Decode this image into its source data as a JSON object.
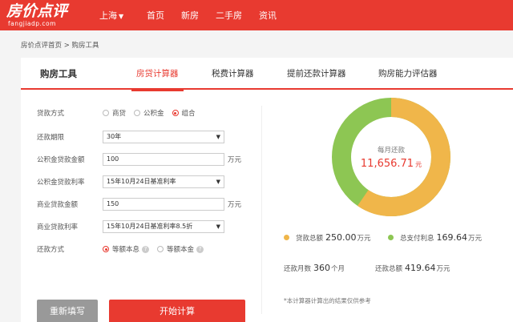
{
  "header": {
    "logo_main": "房价点评",
    "logo_sub": "fangjiadp.com",
    "city": "上海",
    "city_arrow": "▼",
    "nav": [
      "首页",
      "新房",
      "二手房",
      "资讯"
    ]
  },
  "breadcrumb": "房价点评首页 > 购房工具",
  "tools": {
    "title": "购房工具",
    "tabs": [
      "房贷计算器",
      "税费计算器",
      "提前还款计算器",
      "购房能力评估器"
    ]
  },
  "form": {
    "loan_type_label": "贷款方式",
    "loan_type_options": [
      "商贷",
      "公积金",
      "组合"
    ],
    "term_label": "还款期限",
    "term_value": "30年",
    "fund_amount_label": "公积金贷款金额",
    "fund_amount_value": "100",
    "fund_amount_unit": "万元",
    "fund_rate_label": "公积金贷款利率",
    "fund_rate_value": "15年10月24日基准利率",
    "comm_amount_label": "商业贷款金额",
    "comm_amount_value": "150",
    "comm_amount_unit": "万元",
    "comm_rate_label": "商业贷款利率",
    "comm_rate_value": "15年10月24日基准利率8.5折",
    "repay_label": "还款方式",
    "repay_options": [
      "等额本息",
      "等额本金"
    ],
    "reset_label": "重新填写",
    "calc_label": "开始计算"
  },
  "result": {
    "monthly_label": "每月还款",
    "monthly_value": "11,656.71",
    "monthly_unit": "元",
    "loan_total_label": "贷款总额",
    "loan_total_value": "250.00",
    "loan_total_unit": "万元",
    "interest_label": "总支付利息",
    "interest_value": "169.64",
    "interest_unit": "万元",
    "months_label": "还款月数",
    "months_value": "360",
    "months_unit": "个月",
    "repay_total_label": "还款总额",
    "repay_total_value": "419.64",
    "repay_total_unit": "万元",
    "note": "*本计算器计算出的结果仅供参考"
  },
  "colors": {
    "brand_red": "#e83a30",
    "loan_orange": "#f0b64a",
    "interest_green": "#8dc653"
  }
}
